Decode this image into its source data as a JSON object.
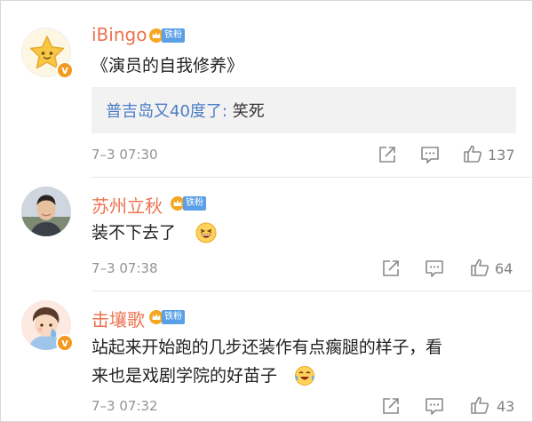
{
  "comments": [
    {
      "username": "iBingo",
      "fan_label": "铁粉",
      "text": "《演员的自我修养》",
      "quote": {
        "link": "普吉岛又40度了:",
        "text": " 笑死"
      },
      "time": "7–3 07:30",
      "likes": "137",
      "avatar_icon": "star-avatar-icon"
    },
    {
      "username": "苏州立秋",
      "fan_label": "铁粉",
      "text": "装不下去了",
      "time": "7–3 07:38",
      "likes": "64",
      "avatar_icon": "man-photo-avatar"
    },
    {
      "username": "击壤歌",
      "fan_label": "铁粉",
      "text_line1": "站起来开始跑的几步还装作有点瘸腿的样子，看",
      "text_line2": "来也是戏剧学院的好苗子",
      "time": "7–3 07:32",
      "likes": "43",
      "avatar_icon": "cartoon-boy-avatar"
    }
  ],
  "colors": {
    "username": "#eb7350",
    "link": "#4d7cc4",
    "verified": "#f39a1e",
    "fan_badge": "#5aa0e6"
  }
}
